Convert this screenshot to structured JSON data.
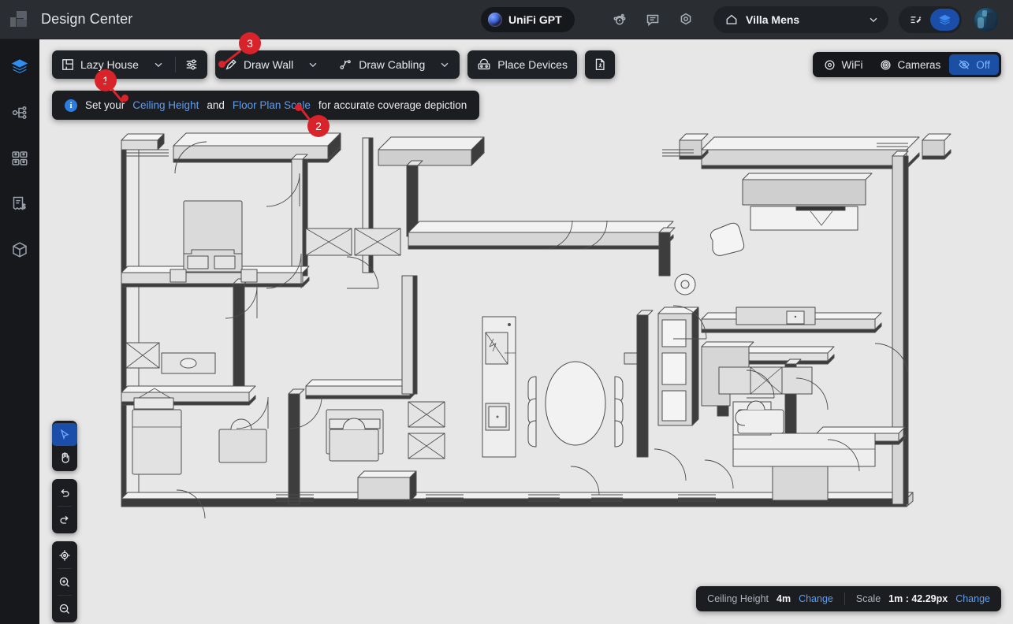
{
  "header": {
    "app_title": "Design Center",
    "logo_icon": "unifi-logo-icon",
    "gpt_button": {
      "label": "UniFi GPT",
      "icon": "gpt-orb-icon"
    },
    "icons": [
      {
        "name": "support-agent-icon"
      },
      {
        "name": "chat-icon"
      },
      {
        "name": "settings-hex-icon"
      }
    ],
    "site_selector": {
      "label": "Villa Mens",
      "icon": "home-icon",
      "chevron": "chevron-down-icon"
    },
    "mode_buttons": [
      {
        "name": "magic-wand-icon",
        "active": false
      },
      {
        "name": "layers-icon",
        "active": true
      }
    ],
    "avatar": "user-avatar"
  },
  "sidebar": {
    "items": [
      {
        "name": "layers",
        "icon": "layers-icon",
        "active": true
      },
      {
        "name": "topology",
        "icon": "topology-icon",
        "active": false
      },
      {
        "name": "clients",
        "icon": "clients-icon",
        "active": false
      },
      {
        "name": "billing",
        "icon": "invoice-icon",
        "active": false
      },
      {
        "name": "3d-view",
        "icon": "cube-icon",
        "active": false
      }
    ]
  },
  "toolbar": {
    "floorplan": {
      "label": "Lazy House",
      "icon": "floorplan-icon",
      "chevron": "chevron-down-icon"
    },
    "settings_icon": "sliders-icon",
    "draw_wall": {
      "label": "Draw Wall",
      "icon": "pencil-icon",
      "chevron": "chevron-down-icon"
    },
    "draw_cabling": {
      "label": "Draw Cabling",
      "icon": "cabling-icon",
      "chevron": "chevron-down-icon"
    },
    "place_devices": {
      "label": "Place Devices",
      "icon": "device-icon"
    },
    "export_pdf": {
      "icon": "pdf-file-icon"
    }
  },
  "view_toggles": [
    {
      "label": "WiFi",
      "icon": "wifi-signal-icon",
      "active": false
    },
    {
      "label": "Cameras",
      "icon": "camera-lens-icon",
      "active": false
    },
    {
      "label": "Off",
      "icon": "eye-off-icon",
      "active": true
    }
  ],
  "banner": {
    "icon": "info-icon",
    "icon_glyph": "i",
    "text_before": "Set your",
    "link1": "Ceiling Height",
    "text_middle": "and",
    "link2": "Floor Plan Scale",
    "text_after": "for accurate coverage depiction"
  },
  "tools": [
    {
      "name": "select-tool",
      "icon": "cursor-icon",
      "active": true
    },
    {
      "name": "pan-tool",
      "icon": "hand-icon",
      "active": false
    },
    {
      "name": "undo",
      "icon": "undo-icon",
      "active": false
    },
    {
      "name": "redo",
      "icon": "redo-icon",
      "active": false
    },
    {
      "name": "recenter",
      "icon": "crosshair-icon",
      "active": false
    },
    {
      "name": "zoom-in",
      "icon": "zoom-in-icon",
      "active": false
    },
    {
      "name": "zoom-out",
      "icon": "zoom-out-icon",
      "active": false
    }
  ],
  "statusbar": {
    "ceiling_label": "Ceiling Height",
    "ceiling_value": "4m",
    "ceiling_change": "Change",
    "scale_label": "Scale",
    "scale_value": "1m : 42.29px",
    "scale_change": "Change"
  },
  "annotations": [
    {
      "number": "1",
      "target": "ceiling-height-link"
    },
    {
      "number": "2",
      "target": "floor-plan-scale-link"
    },
    {
      "number": "3",
      "target": "floorplan-settings-icon"
    }
  ],
  "colors": {
    "header_bg": "#2a2d32",
    "sidebar_bg": "#16181c",
    "canvas_bg": "#e7e7e7",
    "accent_blue": "#2f8ef0",
    "link_blue": "#5a9ef5",
    "active_blue": "#1b4ea8",
    "annotation_red": "#d8232a"
  }
}
